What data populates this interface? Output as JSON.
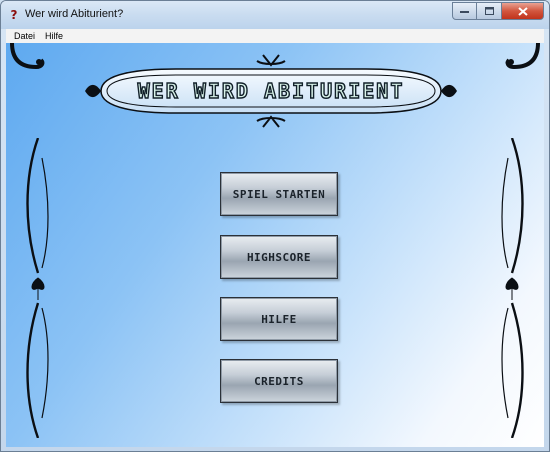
{
  "window": {
    "title": "Wer wird Abiturient?",
    "icon": "question-mark-icon"
  },
  "menubar": {
    "items": [
      "Datei",
      "Hilfe"
    ]
  },
  "main": {
    "logo_text": "Wer wird Abiturient",
    "buttons": [
      "SPIEL STARTEN",
      "HIGHSCORE",
      "HILFE",
      "CREDITS"
    ]
  },
  "colors": {
    "background_gradient_start": "#5ea9f0",
    "background_gradient_end": "#ffffff",
    "button_text": "#1b232b",
    "close_button": "#c0331c"
  }
}
